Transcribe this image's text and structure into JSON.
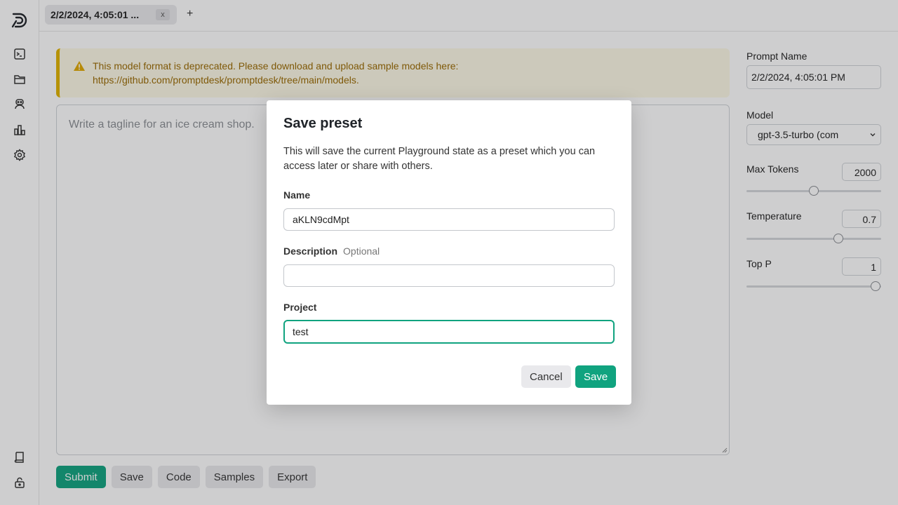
{
  "tabs": [
    {
      "label": "2/2/2024, 4:05:01 ...",
      "close": "x"
    }
  ],
  "tab_add": "+",
  "alert": {
    "line1": "This model format is deprecated. Please download and upload sample models here:",
    "line2": "https://github.com/promptdesk/promptdesk/tree/main/models."
  },
  "prompt": {
    "placeholder": "Write a tagline for an ice cream shop."
  },
  "actions": {
    "submit": "Submit",
    "save": "Save",
    "code": "Code",
    "samples": "Samples",
    "export": "Export"
  },
  "settings": {
    "prompt_name_label": "Prompt Name",
    "prompt_name_value": "2/2/2024, 4:05:01 PM",
    "model_label": "Model",
    "model_value": "gpt-3.5-turbo (com",
    "max_tokens_label": "Max Tokens",
    "max_tokens_value": "2000",
    "temperature_label": "Temperature",
    "temperature_value": "0.7",
    "top_p_label": "Top P",
    "top_p_value": "1"
  },
  "modal": {
    "title": "Save preset",
    "description": "This will save the current Playground state as a preset which you can access later or share with others.",
    "name_label": "Name",
    "name_value": "aKLN9cdMpt",
    "description_label": "Description",
    "description_optional": "Optional",
    "description_value": "",
    "project_label": "Project",
    "project_value": "test",
    "cancel": "Cancel",
    "save": "Save"
  },
  "colors": {
    "accent": "#10a37f",
    "alert_bg": "#fdf9e6",
    "alert_border": "#e0b300",
    "alert_text": "#9a6a00"
  },
  "icons": [
    "logo-icon",
    "terminal-icon",
    "folder-icon",
    "robot-icon",
    "chart-icon",
    "gear-icon",
    "book-icon",
    "lock-icon",
    "warning-icon",
    "chevron-down-icon"
  ]
}
